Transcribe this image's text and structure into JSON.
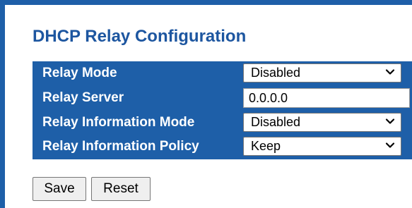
{
  "page": {
    "title": "DHCP Relay Configuration"
  },
  "config": {
    "relay_mode": {
      "label": "Relay Mode",
      "value": "Disabled",
      "type": "select"
    },
    "relay_server": {
      "label": "Relay Server",
      "value": "0.0.0.0",
      "type": "text"
    },
    "relay_information_mode": {
      "label": "Relay Information Mode",
      "value": "Disabled",
      "type": "select"
    },
    "relay_information_policy": {
      "label": "Relay Information Policy",
      "value": "Keep",
      "type": "select"
    }
  },
  "buttons": {
    "save_label": "Save",
    "reset_label": "Reset"
  },
  "colors": {
    "accent": "#1e5fa8",
    "title": "#1d56a0",
    "label_text": "#ffffff"
  },
  "icons": {
    "dropdown": "chevron-down-icon"
  }
}
